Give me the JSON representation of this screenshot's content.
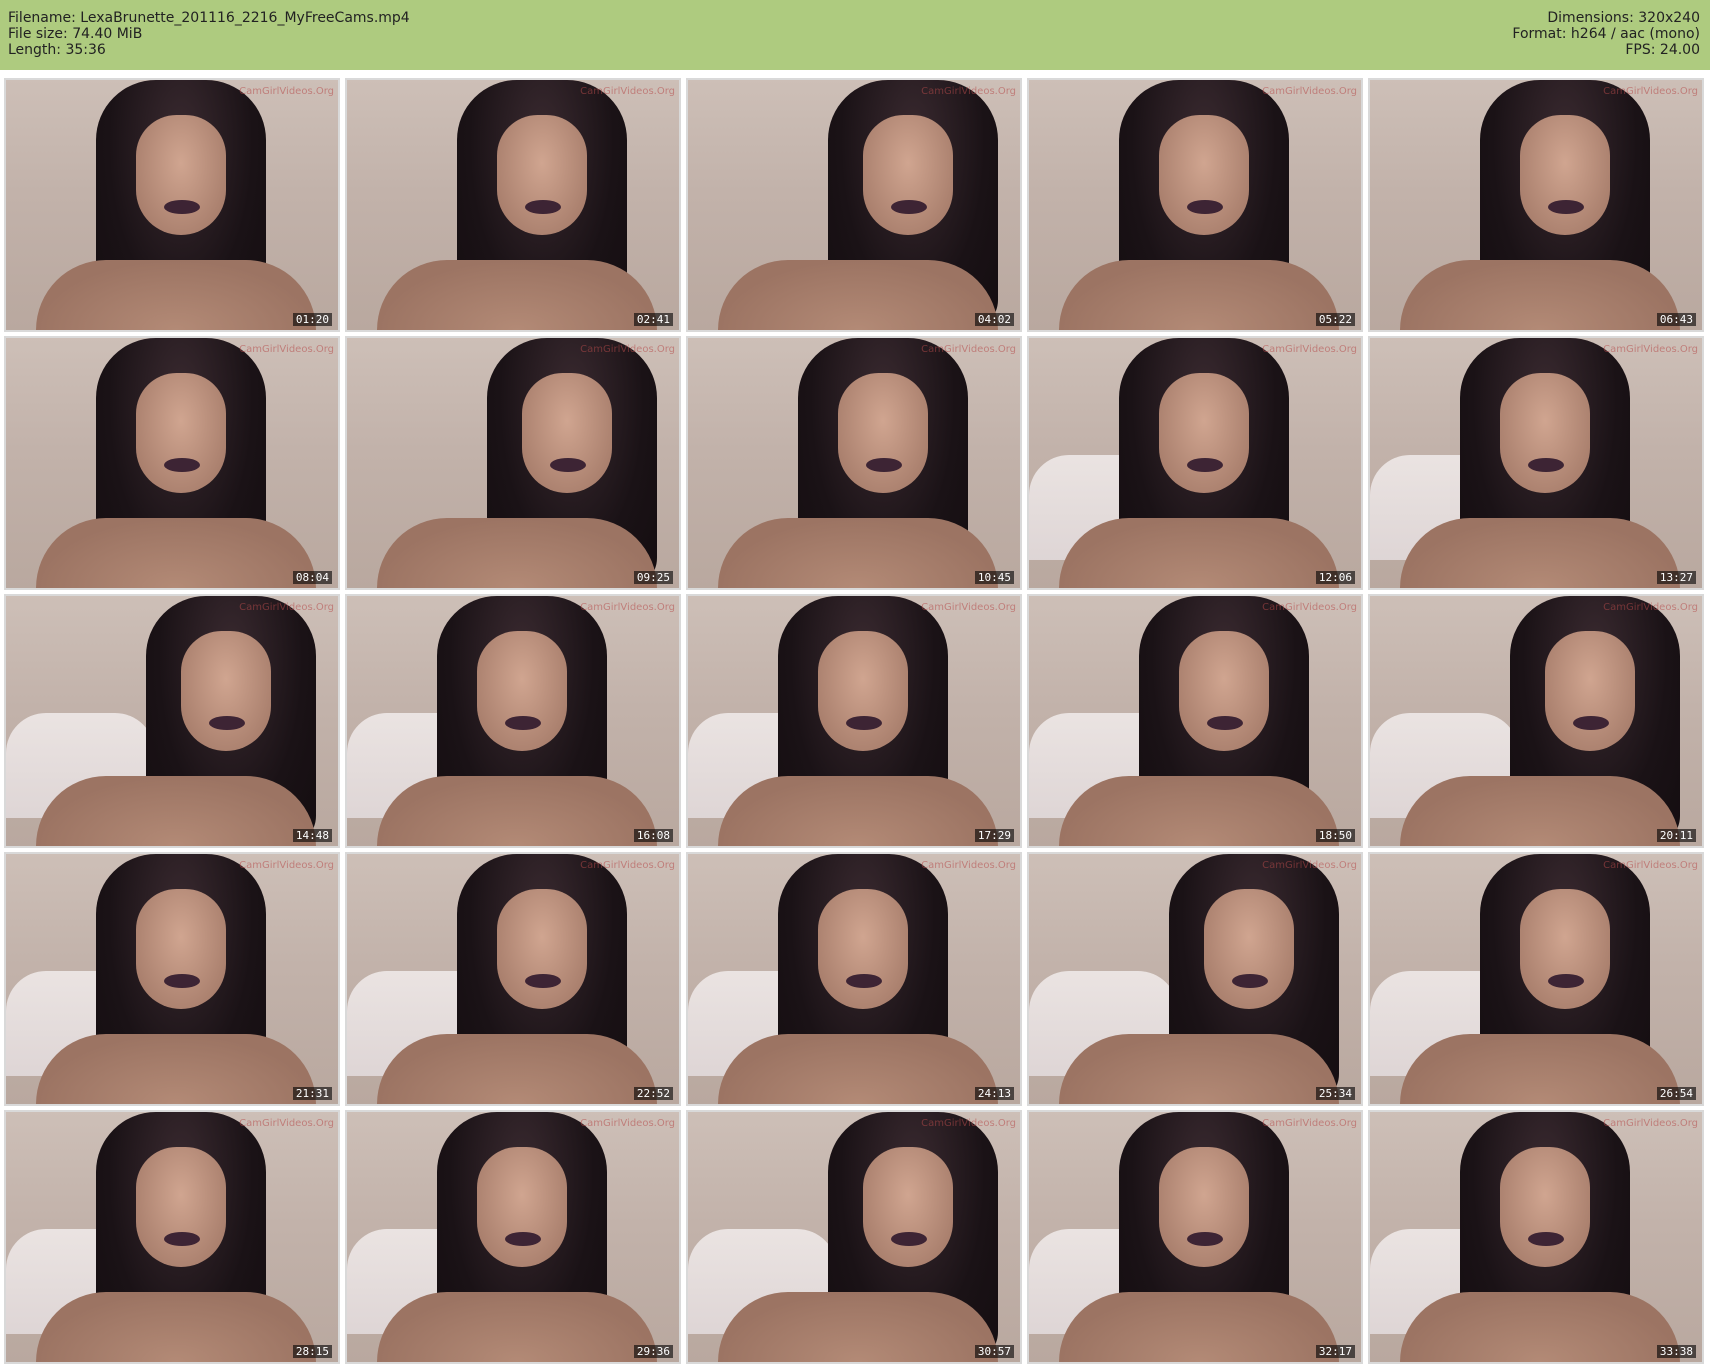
{
  "meta": {
    "filename": "Filename: LexaBrunette_201116_2216_MyFreeCams.mp4",
    "filesize": "File size: 74.40 MiB",
    "length": "Length: 35:36",
    "dimensions": "Dimensions: 320x240",
    "format": "Format: h264 / aac (mono)",
    "fps": "FPS: 24.00"
  },
  "thumbnails": [
    {
      "time": "01:20"
    },
    {
      "time": "02:41"
    },
    {
      "time": "04:02"
    },
    {
      "time": "05:22"
    },
    {
      "time": "06:43"
    },
    {
      "time": "08:04"
    },
    {
      "time": "09:25"
    },
    {
      "time": "10:45"
    },
    {
      "time": "12:06"
    },
    {
      "time": "13:27"
    },
    {
      "time": "14:48"
    },
    {
      "time": "16:08"
    },
    {
      "time": "17:29"
    },
    {
      "time": "18:50"
    },
    {
      "time": "20:11"
    },
    {
      "time": "21:31"
    },
    {
      "time": "22:52"
    },
    {
      "time": "24:13"
    },
    {
      "time": "25:34"
    },
    {
      "time": "26:54"
    },
    {
      "time": "28:15"
    },
    {
      "time": "29:36"
    },
    {
      "time": "30:57"
    },
    {
      "time": "32:17"
    },
    {
      "time": "33:38"
    }
  ],
  "watermark": "CamGirlVideos.Org",
  "colors": {
    "header_bg": "#aecb7f"
  }
}
